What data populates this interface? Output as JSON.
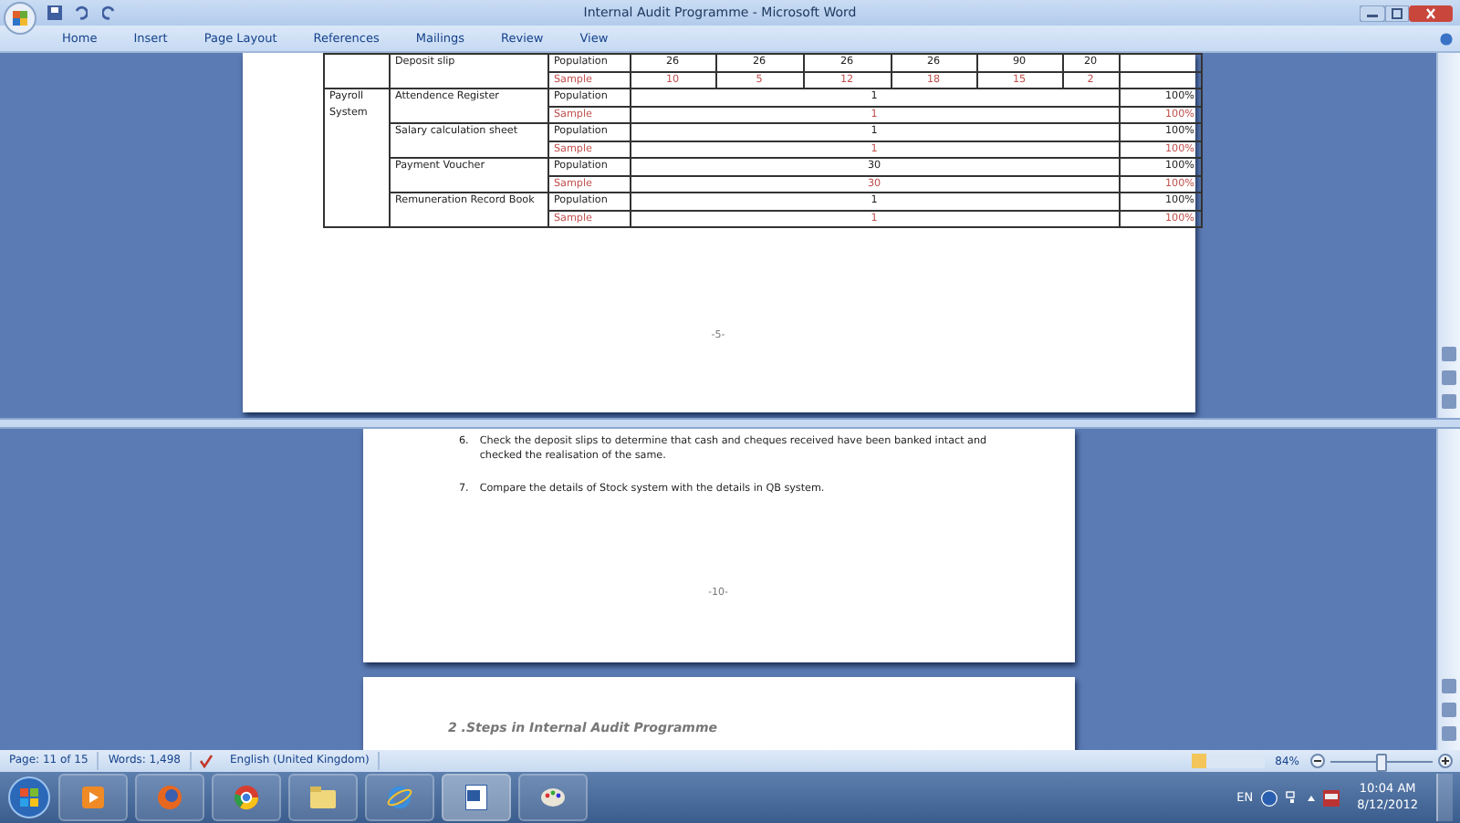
{
  "window": {
    "title": "Internal Audit Programme - Microsoft Word"
  },
  "ribbon_tabs": [
    "Home",
    "Insert",
    "Page Layout",
    "References",
    "Mailings",
    "Review",
    "View"
  ],
  "table": {
    "top_rows": [
      {
        "item": "Deposit slip",
        "population_label": "Population",
        "sample_label": "Sample",
        "population_values": [
          "26",
          "26",
          "26",
          "26",
          "90",
          "20"
        ],
        "sample_values": [
          "10",
          "5",
          "12",
          "18",
          "15",
          "2"
        ]
      }
    ],
    "groups": [
      {
        "name": "Payroll System",
        "items": [
          {
            "item": "Attendence Register",
            "population_label": "Population",
            "population": "1",
            "population_pct": "100%",
            "sample_label": "Sample",
            "sample": "1",
            "sample_pct": "100%"
          },
          {
            "item": "Salary calculation sheet",
            "population_label": "Population",
            "population": "1",
            "population_pct": "100%",
            "sample_label": "Sample",
            "sample": "1",
            "sample_pct": "100%"
          },
          {
            "item": "Payment Voucher",
            "population_label": "Population",
            "population": "30",
            "population_pct": "100%",
            "sample_label": "Sample",
            "sample": "30",
            "sample_pct": "100%"
          },
          {
            "item": "Remuneration Record Book",
            "population_label": "Population",
            "population": "1",
            "population_pct": "100%",
            "sample_label": "Sample",
            "sample": "1",
            "sample_pct": "100%"
          }
        ]
      }
    ]
  },
  "upper_page_number": "-5-",
  "steps": [
    {
      "number": "6.",
      "text": "Check the deposit slips to determine that cash and cheques received have been banked intact and checked the realisation of the same."
    },
    {
      "number": "7.",
      "text": "Compare the details of Stock system with the details in QB system."
    }
  ],
  "lower_page_number": "-10-",
  "next_page_heading": "2 .Steps in Internal Audit Programme",
  "status_bar": {
    "page": "Page: 11 of 15",
    "words": "Words: 1,498",
    "language": "English (United Kingdom)",
    "zoom": "84%",
    "zoom_slider": {
      "level": 0.5
    }
  },
  "taskbar": {
    "language": "EN",
    "time": "10:04 AM",
    "date": "8/12/2012"
  }
}
